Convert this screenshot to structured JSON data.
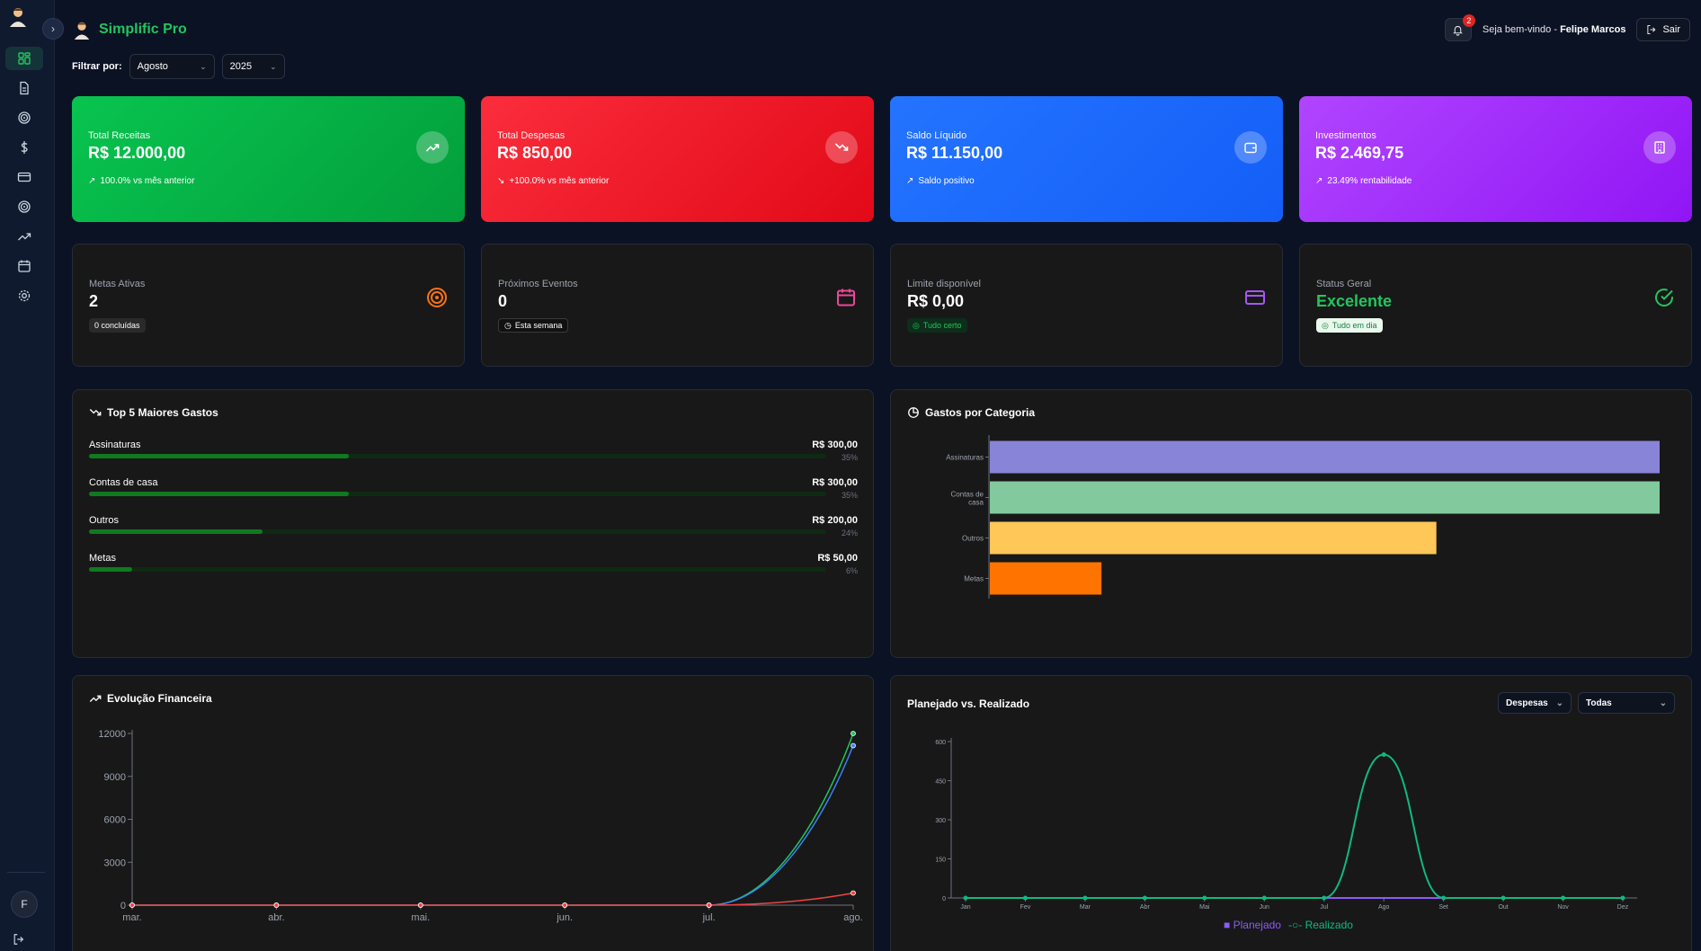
{
  "app": {
    "name": "Simplific Pro",
    "user_initial": "F"
  },
  "header": {
    "welcome_prefix": "Seja bem-vindo - ",
    "user_name": "Felipe Marcos",
    "logout_label": "Sair",
    "notifications_count": "2"
  },
  "filter": {
    "label": "Filtrar por:",
    "month": "Agosto",
    "year": "2025"
  },
  "kpis": [
    {
      "label": "Total Receitas",
      "value": "R$ 12.000,00",
      "sub": "100.0% vs mês anterior",
      "icon": "trending-up-icon"
    },
    {
      "label": "Total Despesas",
      "value": "R$ 850,00",
      "sub": "+100.0% vs mês anterior",
      "icon": "trending-down-icon"
    },
    {
      "label": "Saldo Líquido",
      "value": "R$ 11.150,00",
      "sub": "Saldo positivo",
      "icon": "wallet-icon"
    },
    {
      "label": "Investimentos",
      "value": "R$ 2.469,75",
      "sub": "23.49% rentabilidade",
      "icon": "building-icon"
    }
  ],
  "stats": [
    {
      "label": "Metas Ativas",
      "value": "2",
      "pill": "0 concluídas",
      "icon": "target-icon",
      "color": "#f97316"
    },
    {
      "label": "Próximos Eventos",
      "value": "0",
      "pill": "Esta semana",
      "icon": "calendar-icon",
      "color": "#ec4899"
    },
    {
      "label": "Limite disponível",
      "value": "R$ 0,00",
      "pill": "Tudo certo",
      "icon": "credit-card-icon",
      "color": "#a855f7"
    },
    {
      "label": "Status Geral",
      "value": "Excelente",
      "pill": "Tudo em dia",
      "icon": "check-circle-icon",
      "color": "#22c55e"
    }
  ],
  "top5": {
    "title": "Top 5 Maiores Gastos",
    "items": [
      {
        "name": "Assinaturas",
        "amount": "R$ 300,00",
        "pct": "35%",
        "fraction": 0.353
      },
      {
        "name": "Contas de casa",
        "amount": "R$ 300,00",
        "pct": "35%",
        "fraction": 0.353
      },
      {
        "name": "Outros",
        "amount": "R$ 200,00",
        "pct": "24%",
        "fraction": 0.235
      },
      {
        "name": "Metas",
        "amount": "R$ 50,00",
        "pct": "6%",
        "fraction": 0.059
      }
    ]
  },
  "gastos_categoria": {
    "title": "Gastos por Categoria"
  },
  "evolucao": {
    "title": "Evolução Financeira"
  },
  "planejado": {
    "title": "Planejado vs. Realizado",
    "select_type": "Despesas",
    "select_scope": "Todas",
    "legend_planned": "Planejado",
    "legend_realized": "Realizado"
  },
  "colors": {
    "green": "#22c55e",
    "red": "#ef4444",
    "blue": "#3b82f6",
    "purple": "#a855f7",
    "orange": "#f97316"
  },
  "chart_data": [
    {
      "type": "bar",
      "orientation": "horizontal",
      "categories": [
        "Assinaturas",
        "Contas de casa",
        "Outros",
        "Metas"
      ],
      "values": [
        300,
        300,
        200,
        50
      ],
      "colors": [
        "#8884d8",
        "#82ca9d",
        "#ffc658",
        "#ff7300"
      ],
      "xlim": [
        0,
        300
      ]
    },
    {
      "type": "line",
      "x": [
        "mar.",
        "abr.",
        "mai.",
        "jun.",
        "jul.",
        "ago."
      ],
      "yticks": [
        0,
        3000,
        6000,
        9000,
        12000
      ],
      "ylim": [
        0,
        12000
      ],
      "series": [
        {
          "values": [
            0,
            0,
            0,
            0,
            0,
            12000
          ],
          "color": "#22c55e"
        },
        {
          "values": [
            0,
            0,
            0,
            0,
            0,
            11150
          ],
          "color": "#3b82f6"
        },
        {
          "values": [
            0,
            0,
            0,
            0,
            0,
            850
          ],
          "color": "#ef4444"
        }
      ]
    },
    {
      "type": "line",
      "x": [
        "Jan",
        "Fev",
        "Mar",
        "Abr",
        "Mai",
        "Jun",
        "Jul",
        "Ago",
        "Set",
        "Out",
        "Nov",
        "Dez"
      ],
      "yticks": [
        0,
        150,
        300,
        450,
        600
      ],
      "ylim": [
        0,
        600
      ],
      "series": [
        {
          "name": "Planejado",
          "values": [
            0,
            0,
            0,
            0,
            0,
            0,
            0,
            0,
            0,
            0,
            0,
            0
          ],
          "color": "#8b5cf6"
        },
        {
          "name": "Realizado",
          "values": [
            0,
            0,
            0,
            0,
            0,
            0,
            0,
            550,
            0,
            0,
            0,
            0
          ],
          "color": "#10b981"
        }
      ]
    }
  ]
}
